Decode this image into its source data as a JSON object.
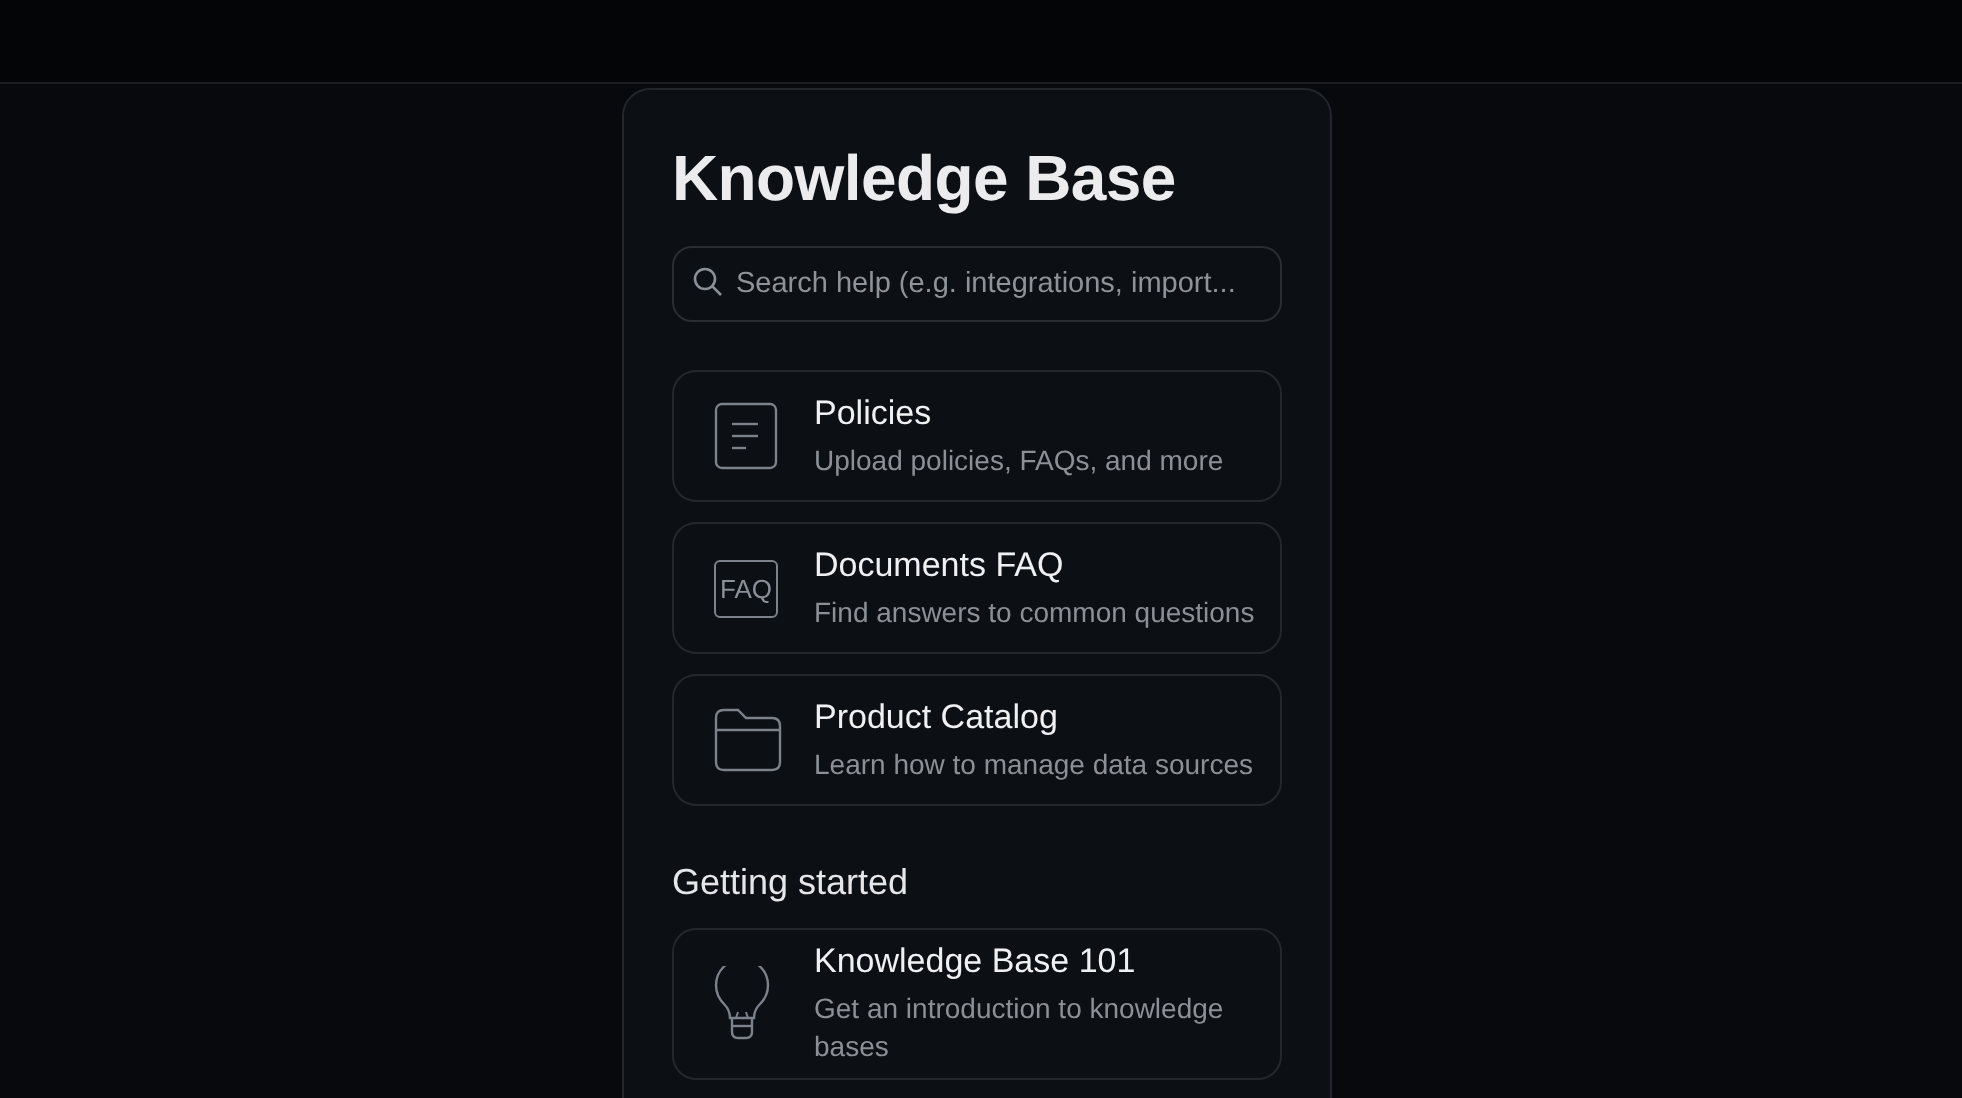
{
  "title": "Knowledge Base",
  "search": {
    "placeholder": "Search help (e.g. integrations, import..."
  },
  "items": [
    {
      "kind": "document",
      "title": "Policies",
      "description": "Upload policies, FAQs, and more"
    },
    {
      "kind": "faq",
      "icon_text": "FAQ",
      "title": "Documents FAQ",
      "description": "Find answers to common questions"
    },
    {
      "kind": "folder",
      "title": "Product Catalog",
      "description": "Learn how to manage data sources"
    }
  ],
  "getting_started": {
    "heading": "Getting started",
    "items": [
      {
        "kind": "bulb",
        "title": "Knowledge Base 101",
        "description": "Get an introduction to knowledge bases"
      }
    ]
  }
}
